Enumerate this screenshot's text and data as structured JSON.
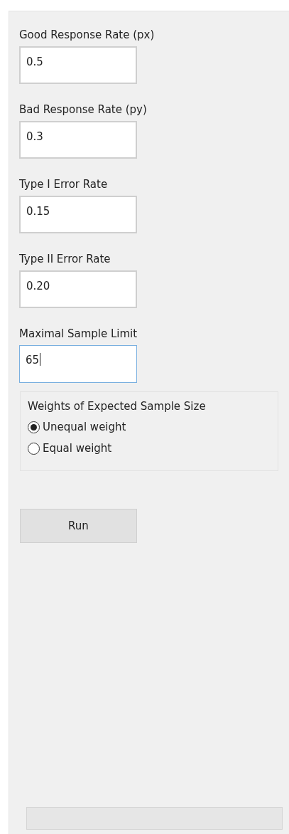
{
  "fields": [
    {
      "label": "Good Response Rate (px)",
      "value": "0.5",
      "focused": false
    },
    {
      "label": "Bad Response Rate (py)",
      "value": "0.3",
      "focused": false
    },
    {
      "label": "Type I Error Rate",
      "value": "0.15",
      "focused": false
    },
    {
      "label": "Type II Error Rate",
      "value": "0.20",
      "focused": false
    },
    {
      "label": "Maximal Sample Limit",
      "value": "65",
      "focused": true
    }
  ],
  "weights_group": {
    "title": "Weights of Expected Sample Size",
    "options": [
      {
        "label": "Unequal weight",
        "selected": true
      },
      {
        "label": "Equal weight",
        "selected": false
      }
    ]
  },
  "run_button": {
    "label": "Run"
  },
  "progress_bar": {
    "level": 0
  }
}
